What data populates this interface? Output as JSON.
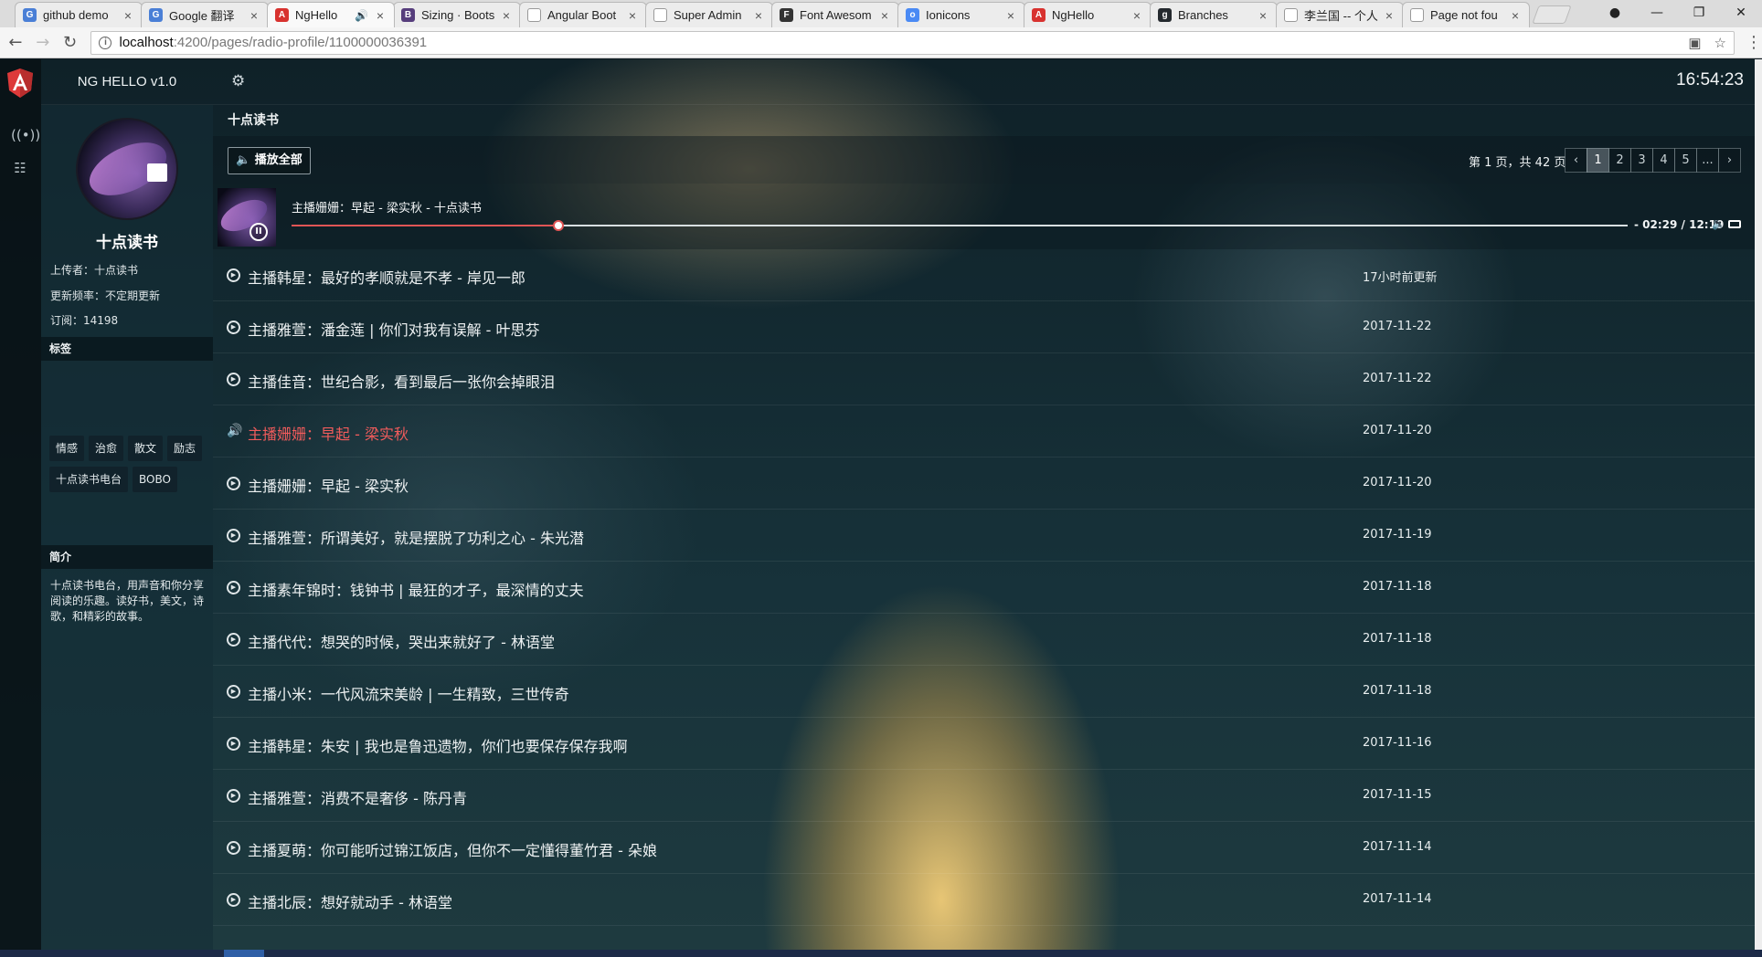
{
  "browser": {
    "tabs": [
      {
        "title": "github demo",
        "favicon_color": "#4a7fd6",
        "favicon_glyph": "G",
        "active": false
      },
      {
        "title": "Google 翻译",
        "favicon_color": "#4a7fd6",
        "favicon_glyph": "G",
        "active": false
      },
      {
        "title": "NgHello",
        "favicon_color": "#d8322f",
        "favicon_glyph": "A",
        "active": true,
        "audio": true
      },
      {
        "title": "Sizing · Boots",
        "favicon_color": "#563d7c",
        "favicon_glyph": "B",
        "active": false
      },
      {
        "title": "Angular Boot",
        "favicon_color": "#ffffff",
        "favicon_glyph": "",
        "active": false
      },
      {
        "title": "Super Admin",
        "favicon_color": "#ffffff",
        "favicon_glyph": "",
        "active": false
      },
      {
        "title": "Font Awesom",
        "favicon_color": "#333333",
        "favicon_glyph": "F",
        "active": false
      },
      {
        "title": "Ionicons",
        "favicon_color": "#4a8af4",
        "favicon_glyph": "o",
        "active": false
      },
      {
        "title": "NgHello",
        "favicon_color": "#d8322f",
        "favicon_glyph": "A",
        "active": false
      },
      {
        "title": "Branches",
        "favicon_color": "#24292e",
        "favicon_glyph": "g",
        "active": false
      },
      {
        "title": "李兰国 -- 个人",
        "favicon_color": "#ffffff",
        "favicon_glyph": "",
        "active": false
      },
      {
        "title": "Page not fou",
        "favicon_color": "#ffffff",
        "favicon_glyph": "",
        "active": false
      }
    ],
    "url_host": "localhost",
    "url_path": ":4200/pages/radio-profile/1100000036391"
  },
  "app": {
    "brand": "NG HELLO v1.0",
    "clock": "16:54:23",
    "accent_color": "#f25c5c"
  },
  "profile": {
    "name": "十点读书",
    "uploader": "上传者：十点读书",
    "frequency": "更新频率：不定期更新",
    "subscribers": "订阅：14198",
    "tags_heading": "标签",
    "tags": [
      "情感",
      "治愈",
      "散文",
      "励志",
      "十点读书电台",
      "BOBO"
    ],
    "intro_heading": "简介",
    "intro": "十点读书电台，用声音和你分享阅读的乐趣。读好书，美文，诗歌，和精彩的故事。"
  },
  "list": {
    "title": "十点读书",
    "play_all": "播放全部",
    "page_info": "第 1 页，共 42 页",
    "pages": [
      "‹",
      "1",
      "2",
      "3",
      "4",
      "5",
      "...",
      "›"
    ],
    "current_page": "1"
  },
  "player": {
    "title": "主播姗姗：早起 - 梁实秋 - 十点读书",
    "time": "- 02:29 / 12:19",
    "progress": 0.2
  },
  "tracks": [
    {
      "title": "主播韩星：最好的孝顺就是不孝 - 岸见一郎",
      "date": "17小时前更新",
      "playing": false
    },
    {
      "title": "主播雅萱：潘金莲 | 你们对我有误解 - 叶思芬",
      "date": "2017-11-22",
      "playing": false
    },
    {
      "title": "主播佳音：世纪合影，看到最后一张你会掉眼泪",
      "date": "2017-11-22",
      "playing": false
    },
    {
      "title": "主播姗姗：早起 - 梁实秋",
      "date": "2017-11-20",
      "playing": true
    },
    {
      "title": "主播姗姗：早起 - 梁实秋",
      "date": "2017-11-20",
      "playing": false
    },
    {
      "title": "主播雅萱：所谓美好，就是摆脱了功利之心 - 朱光潜",
      "date": "2017-11-19",
      "playing": false
    },
    {
      "title": "主播素年锦时：钱钟书 | 最狂的才子，最深情的丈夫",
      "date": "2017-11-18",
      "playing": false
    },
    {
      "title": "主播代代：想哭的时候，哭出来就好了 - 林语堂",
      "date": "2017-11-18",
      "playing": false
    },
    {
      "title": "主播小米：一代风流宋美龄 | 一生精致，三世传奇",
      "date": "2017-11-18",
      "playing": false
    },
    {
      "title": "主播韩星：朱安 | 我也是鲁迅遗物，你们也要保存保存我啊",
      "date": "2017-11-16",
      "playing": false
    },
    {
      "title": "主播雅萱：消费不是奢侈 - 陈丹青",
      "date": "2017-11-15",
      "playing": false
    },
    {
      "title": "主播夏萌：你可能听过锦江饭店，但你不一定懂得董竹君 - 朵娘",
      "date": "2017-11-14",
      "playing": false
    },
    {
      "title": "主播北辰：想好就动手 - 林语堂",
      "date": "2017-11-14",
      "playing": false
    }
  ]
}
